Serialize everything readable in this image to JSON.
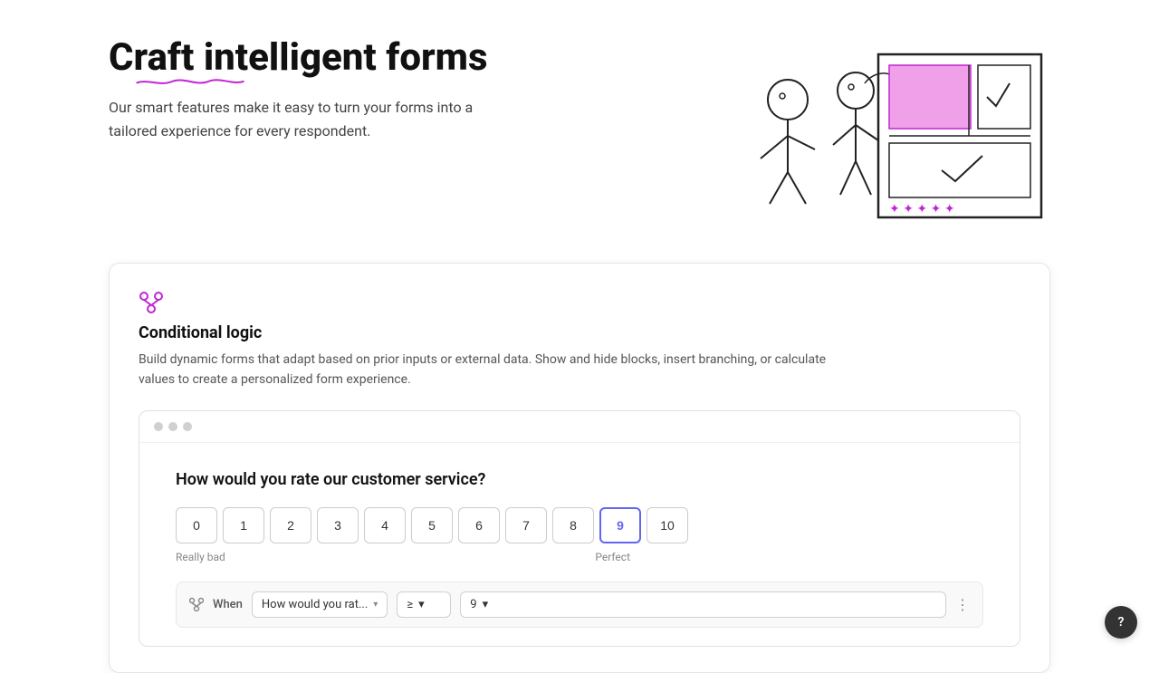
{
  "header": {
    "title": "Craft intelligent forms",
    "subtitle": "Our smart features make it easy to turn your forms into a tailored experience for every respondent."
  },
  "card": {
    "title": "Conditional logic",
    "description": "Build dynamic forms that adapt based on prior inputs or external data. Show and hide blocks, insert branching, or calculate values to create a personalized form experience.",
    "icon": "branch-icon"
  },
  "demo": {
    "question": "How would you rate our customer service?",
    "ratings": [
      "0",
      "1",
      "2",
      "3",
      "4",
      "5",
      "6",
      "7",
      "8",
      "9",
      "10"
    ],
    "active_rating": "9",
    "label_bad": "Really bad",
    "label_perfect": "Perfect"
  },
  "condition": {
    "when_label": "When",
    "field_value": "How would you rat...",
    "operator_value": "≥",
    "condition_value": "9"
  },
  "titlebar_dots": [
    "dot1",
    "dot2",
    "dot3"
  ],
  "help_label": "?"
}
